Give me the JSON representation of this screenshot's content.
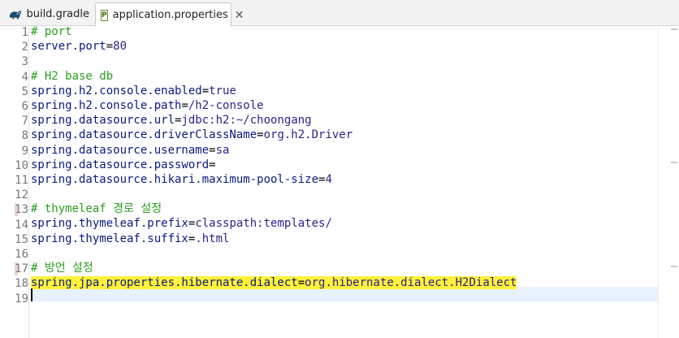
{
  "tabs": [
    {
      "label": "build.gradle",
      "icon": "gradle-elephant-icon",
      "active": false
    },
    {
      "label": "application.properties",
      "icon": "properties-file-icon",
      "file_icon_letter": "P",
      "active": true,
      "close": "✕"
    }
  ],
  "editor": {
    "lines": [
      {
        "num": "1",
        "parts": [
          {
            "t": "# port",
            "c": "comment"
          }
        ]
      },
      {
        "num": "2",
        "parts": [
          {
            "t": "server.port",
            "c": "key"
          },
          {
            "t": "=",
            "c": "eq"
          },
          {
            "t": "80",
            "c": "val"
          }
        ]
      },
      {
        "num": "3",
        "parts": []
      },
      {
        "num": "4",
        "parts": [
          {
            "t": "# H2 base db",
            "c": "comment"
          }
        ]
      },
      {
        "num": "5",
        "parts": [
          {
            "t": "spring.h2.console.enabled",
            "c": "key"
          },
          {
            "t": "=",
            "c": "eq"
          },
          {
            "t": "true",
            "c": "val"
          }
        ]
      },
      {
        "num": "6",
        "parts": [
          {
            "t": "spring.h2.console.path",
            "c": "key"
          },
          {
            "t": "=",
            "c": "eq"
          },
          {
            "t": "/h2-console",
            "c": "val"
          }
        ]
      },
      {
        "num": "7",
        "parts": [
          {
            "t": "spring.datasource.url",
            "c": "key"
          },
          {
            "t": "=",
            "c": "eq"
          },
          {
            "t": "jdbc:h2:~/choongang",
            "c": "val"
          }
        ]
      },
      {
        "num": "8",
        "parts": [
          {
            "t": "spring.datasource.driverClassName",
            "c": "key"
          },
          {
            "t": "=",
            "c": "eq"
          },
          {
            "t": "org.h2.Driver",
            "c": "val"
          }
        ]
      },
      {
        "num": "9",
        "parts": [
          {
            "t": "spring.datasource.username",
            "c": "key"
          },
          {
            "t": "=",
            "c": "eq"
          },
          {
            "t": "sa",
            "c": "val"
          }
        ]
      },
      {
        "num": "10",
        "parts": [
          {
            "t": "spring.datasource.password",
            "c": "key"
          },
          {
            "t": "=",
            "c": "eq"
          }
        ]
      },
      {
        "num": "11",
        "parts": [
          {
            "t": "spring.datasource.hikari.maximum-pool-size",
            "c": "key"
          },
          {
            "t": "=",
            "c": "eq"
          },
          {
            "t": "4",
            "c": "val"
          }
        ]
      },
      {
        "num": "12",
        "parts": []
      },
      {
        "num": "13",
        "parts": [
          {
            "t": "# thymeleaf 경로 설정",
            "c": "comment"
          }
        ]
      },
      {
        "num": "14",
        "parts": [
          {
            "t": "spring.thymeleaf.prefix",
            "c": "key"
          },
          {
            "t": "=",
            "c": "eq"
          },
          {
            "t": "classpath:templates/",
            "c": "val"
          }
        ]
      },
      {
        "num": "15",
        "parts": [
          {
            "t": "spring.thymeleaf.suffix",
            "c": "key"
          },
          {
            "t": "=",
            "c": "eq"
          },
          {
            "t": ".html",
            "c": "val"
          }
        ]
      },
      {
        "num": "16",
        "parts": []
      },
      {
        "num": "17",
        "parts": [
          {
            "t": "# 방언 설정",
            "c": "comment"
          }
        ]
      },
      {
        "num": "18",
        "highlighted": true,
        "parts": [
          {
            "t": "spring.jpa.properties.hibernate.dialect",
            "c": "key"
          },
          {
            "t": "=",
            "c": "eq"
          },
          {
            "t": "org.hibernate.dialect.H2Dialect",
            "c": "val"
          }
        ]
      },
      {
        "num": "19",
        "current": true,
        "parts": []
      }
    ],
    "marked_lines": [
      "13",
      "17"
    ]
  },
  "colors": {
    "comment": "#2a9d1f",
    "key": "#0a1a80",
    "value": "#2d1f8c",
    "highlight": "#fff13a",
    "current_line": "#e8f2fe"
  }
}
